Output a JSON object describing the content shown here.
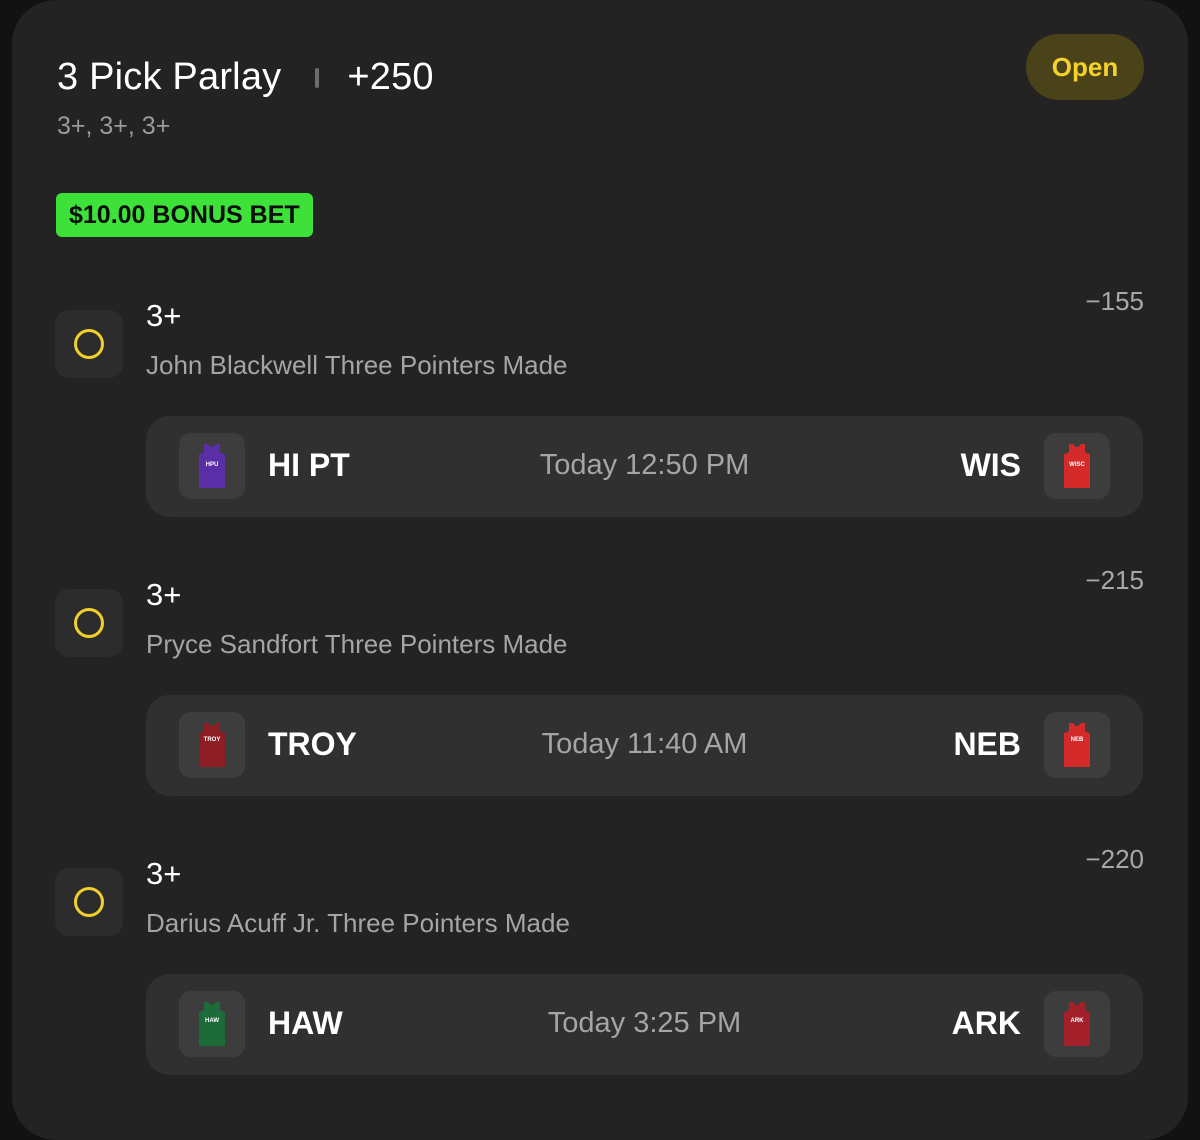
{
  "bet": {
    "title": "3 Pick Parlay",
    "odds": "+250",
    "summary": "3+, 3+, 3+",
    "status": "Open",
    "bonus_label": "$10.00 BONUS BET"
  },
  "colors": {
    "card_bg": "#232323",
    "status_bg": "#4a4218",
    "status_text": "#f4d22b",
    "bonus_bg": "#3ee13a",
    "pending_ring": "#f2cf2a"
  },
  "legs": [
    {
      "line": "3+",
      "odds": "−155",
      "description": "John Blackwell Three Pointers Made",
      "away": {
        "abbr": "HI PT",
        "jersey_text": "HPU",
        "jersey_color": "#5a2ea6"
      },
      "time": "Today 12:50 PM",
      "home": {
        "abbr": "WIS",
        "jersey_text": "WISC",
        "jersey_color": "#d42a2a"
      }
    },
    {
      "line": "3+",
      "odds": "−215",
      "description": "Pryce Sandfort Three Pointers Made",
      "away": {
        "abbr": "TROY",
        "jersey_text": "TROY",
        "jersey_color": "#8e1e25"
      },
      "time": "Today 11:40 AM",
      "home": {
        "abbr": "NEB",
        "jersey_text": "NEB",
        "jersey_color": "#d42a2a"
      }
    },
    {
      "line": "3+",
      "odds": "−220",
      "description": "Darius Acuff Jr. Three Pointers Made",
      "away": {
        "abbr": "HAW",
        "jersey_text": "HAW",
        "jersey_color": "#1e6b3a"
      },
      "time": "Today 3:25 PM",
      "home": {
        "abbr": "ARK",
        "jersey_text": "ARK",
        "jersey_color": "#a3202a"
      }
    }
  ]
}
